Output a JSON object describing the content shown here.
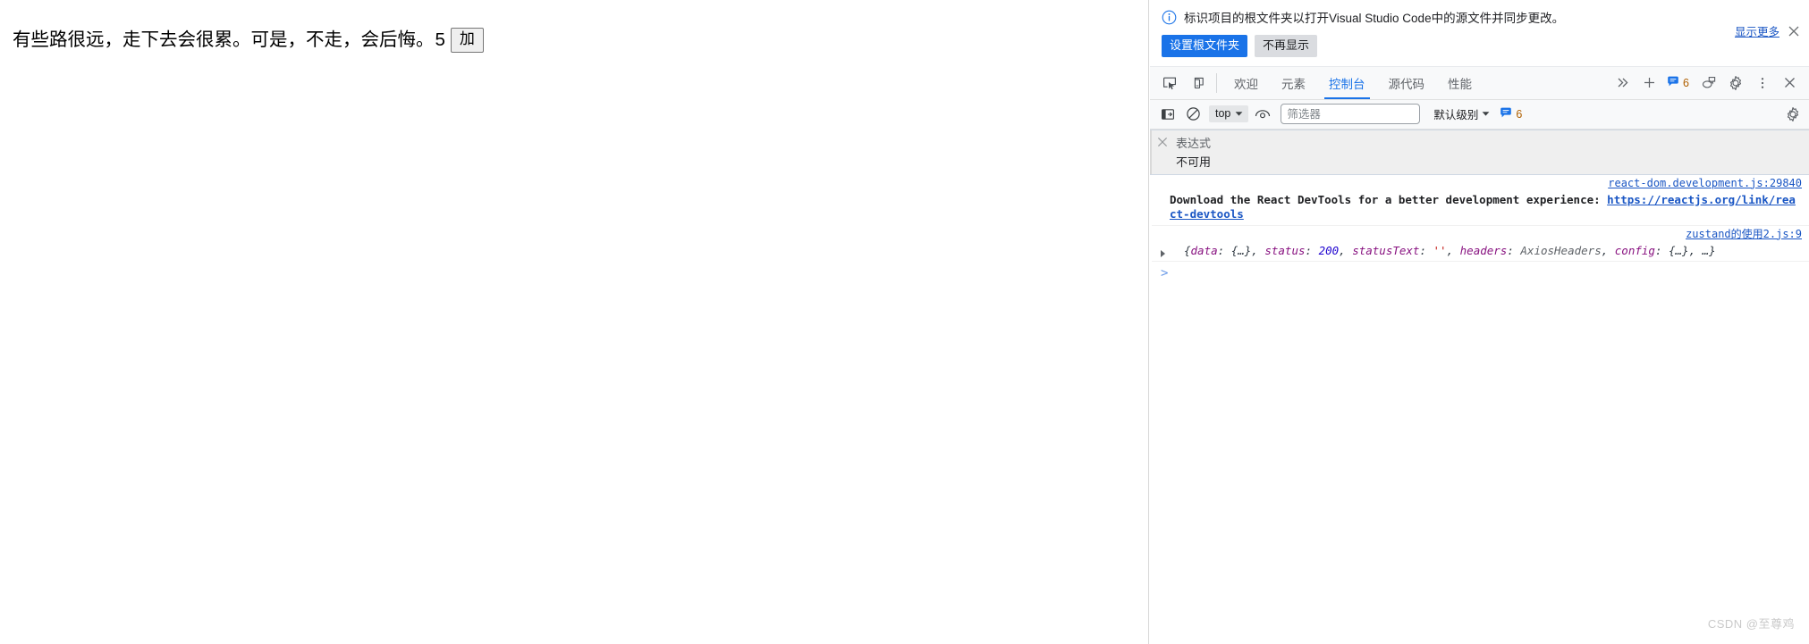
{
  "page": {
    "quote": "有些路很远，走下去会很累。可是，不走，会后悔。",
    "count": "5",
    "add_button": "加"
  },
  "devtools": {
    "infobar": {
      "icon": "info-icon",
      "message": "标识项目的根文件夹以打开Visual Studio Code中的源文件并同步更改。",
      "primary_button": "设置根文件夹",
      "secondary_button": "不再显示",
      "show_more_link": "显示更多",
      "close_icon": "close-icon"
    },
    "tabstrip": {
      "inspect_icon": "inspect-element-icon",
      "device_toolbar_icon": "device-toolbar-icon",
      "tabs": [
        {
          "label": "欢迎",
          "active": false
        },
        {
          "label": "元素",
          "active": false
        },
        {
          "label": "控制台",
          "active": true
        },
        {
          "label": "源代码",
          "active": false
        },
        {
          "label": "性能",
          "active": false
        }
      ],
      "more_tabs_icon": "chevron-double-right-icon",
      "add_tab_icon": "plus-icon",
      "issues_count": "6",
      "issues_icon": "message-badge-icon",
      "feedback_icon": "feedback-icon",
      "settings_icon": "gear-icon",
      "more_options_icon": "kebab-menu-icon",
      "close_icon": "close-icon"
    },
    "console_toolbar": {
      "sidebar_icon": "console-sidebar-icon",
      "clear_icon": "clear-console-icon",
      "context": "top",
      "context_chevron": "chevron-down-icon",
      "eye_icon": "live-expression-icon",
      "filter_placeholder": "筛选器",
      "filter_value": "",
      "levels_label": "默认级别",
      "levels_chevron": "chevron-down-icon",
      "issues_count": "6",
      "issues_icon": "message-badge-icon",
      "settings_icon": "gear-icon"
    },
    "live_expression": {
      "close_icon": "close-icon",
      "title": "表达式",
      "value": "不可用"
    },
    "console_log": {
      "entries": [
        {
          "source": "react-dom.development.js:29840",
          "text": "Download the React DevTools for a better development experience: ",
          "link": "https://reactjs.org/link/react-devtools",
          "type": "log"
        },
        {
          "source": "zustand的使用2.js:9",
          "type": "object",
          "expand_icon": "expand-triangle-icon",
          "tokens": [
            {
              "t": "plain",
              "v": "{"
            },
            {
              "t": "key",
              "v": "data"
            },
            {
              "t": "plain",
              "v": ": "
            },
            {
              "t": "plain",
              "v": "{…}"
            },
            {
              "t": "plain",
              "v": ", "
            },
            {
              "t": "key",
              "v": "status"
            },
            {
              "t": "plain",
              "v": ": "
            },
            {
              "t": "num",
              "v": "200"
            },
            {
              "t": "plain",
              "v": ", "
            },
            {
              "t": "key",
              "v": "statusText"
            },
            {
              "t": "plain",
              "v": ": "
            },
            {
              "t": "str",
              "v": "''"
            },
            {
              "t": "plain",
              "v": ", "
            },
            {
              "t": "key",
              "v": "headers"
            },
            {
              "t": "plain",
              "v": ": "
            },
            {
              "t": "cls",
              "v": "AxiosHeaders"
            },
            {
              "t": "plain",
              "v": ", "
            },
            {
              "t": "key",
              "v": "config"
            },
            {
              "t": "plain",
              "v": ": "
            },
            {
              "t": "plain",
              "v": "{…}, …}"
            }
          ]
        }
      ]
    },
    "prompt": {
      "chevron": "prompt-chevron-icon",
      "value": ""
    }
  },
  "watermark": "CSDN @至尊鸡",
  "colors": {
    "accent_blue": "#1a73e8",
    "link_blue": "#1a56c4",
    "toolbar_bg": "#f8f9fa",
    "live_expr_bg": "#efefef",
    "badge_orange": "#b06000"
  }
}
